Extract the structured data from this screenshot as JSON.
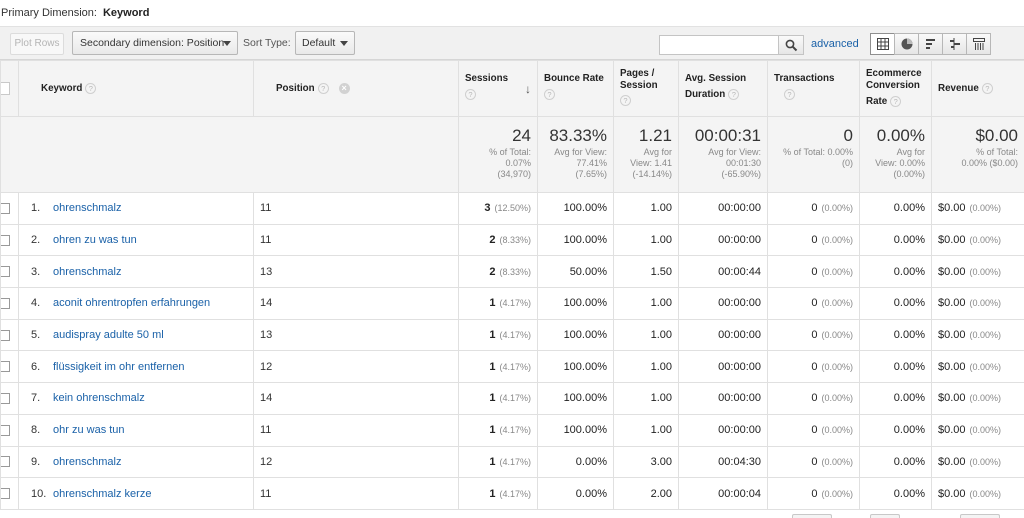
{
  "primary_dimension": {
    "label": "Primary Dimension:",
    "value": "Keyword"
  },
  "toolbar": {
    "plot_rows": "Plot Rows",
    "secondary_dimension": "Secondary dimension: Position",
    "sort_type_label": "Sort Type:",
    "sort_type_value": "Default",
    "search_value": "",
    "advanced": "advanced",
    "view_icons": [
      "table-view-icon",
      "pie-view-icon",
      "performance-view-icon",
      "comparison-view-icon",
      "pivot-view-icon"
    ]
  },
  "columns": {
    "keyword": "Keyword",
    "position": "Position",
    "sessions": "Sessions",
    "bounce_rate": "Bounce Rate",
    "pages_l1": "Pages /",
    "pages_l2": "Session",
    "avg_l1": "Avg. Session",
    "avg_l2": "Duration",
    "transactions": "Transactions",
    "ecom_l1": "Ecommerce",
    "ecom_l2": "Conversion",
    "ecom_l3": "Rate",
    "revenue": "Revenue"
  },
  "totals": {
    "sessions": {
      "big": "24",
      "l1": "% of Total:",
      "l2": "0.07%",
      "l3": "(34,970)"
    },
    "bounce": {
      "big": "83.33%",
      "l1": "Avg for View:",
      "l2": "77.41%",
      "l3": "(7.65%)"
    },
    "pages": {
      "big": "1.21",
      "l1": "Avg for",
      "l2": "View: 1.41",
      "l3": "(-14.14%)"
    },
    "duration": {
      "big": "00:00:31",
      "l1": "Avg for View:",
      "l2": "00:01:30",
      "l3": "(-65.90%)"
    },
    "transactions": {
      "big": "0",
      "l1": "% of Total: 0.00%",
      "l2": "(0)"
    },
    "ecom": {
      "big": "0.00%",
      "l1": "Avg for",
      "l2": "View: 0.00%",
      "l3": "(0.00%)"
    },
    "revenue": {
      "big": "$0.00",
      "l1": "% of Total:",
      "l2": "0.00% ($0.00)"
    }
  },
  "rows": [
    {
      "n": "1.",
      "keyword": "ohrenschmalz",
      "position": "11",
      "sessions": "3",
      "sessions_pct": "(12.50%)",
      "bounce": "100.00%",
      "pages": "1.00",
      "duration": "00:00:00",
      "transactions": "0",
      "transactions_pct": "(0.00%)",
      "ecom": "0.00%",
      "revenue": "$0.00",
      "revenue_pct": "(0.00%)"
    },
    {
      "n": "2.",
      "keyword": "ohren zu was tun",
      "position": "11",
      "sessions": "2",
      "sessions_pct": "(8.33%)",
      "bounce": "100.00%",
      "pages": "1.00",
      "duration": "00:00:00",
      "transactions": "0",
      "transactions_pct": "(0.00%)",
      "ecom": "0.00%",
      "revenue": "$0.00",
      "revenue_pct": "(0.00%)"
    },
    {
      "n": "3.",
      "keyword": "ohrenschmalz",
      "position": "13",
      "sessions": "2",
      "sessions_pct": "(8.33%)",
      "bounce": "50.00%",
      "pages": "1.50",
      "duration": "00:00:44",
      "transactions": "0",
      "transactions_pct": "(0.00%)",
      "ecom": "0.00%",
      "revenue": "$0.00",
      "revenue_pct": "(0.00%)"
    },
    {
      "n": "4.",
      "keyword": "aconit ohrentropfen erfahrungen",
      "position": "14",
      "sessions": "1",
      "sessions_pct": "(4.17%)",
      "bounce": "100.00%",
      "pages": "1.00",
      "duration": "00:00:00",
      "transactions": "0",
      "transactions_pct": "(0.00%)",
      "ecom": "0.00%",
      "revenue": "$0.00",
      "revenue_pct": "(0.00%)"
    },
    {
      "n": "5.",
      "keyword": "audispray adulte 50 ml",
      "position": "13",
      "sessions": "1",
      "sessions_pct": "(4.17%)",
      "bounce": "100.00%",
      "pages": "1.00",
      "duration": "00:00:00",
      "transactions": "0",
      "transactions_pct": "(0.00%)",
      "ecom": "0.00%",
      "revenue": "$0.00",
      "revenue_pct": "(0.00%)"
    },
    {
      "n": "6.",
      "keyword": "flüssigkeit im ohr entfernen",
      "position": "12",
      "sessions": "1",
      "sessions_pct": "(4.17%)",
      "bounce": "100.00%",
      "pages": "1.00",
      "duration": "00:00:00",
      "transactions": "0",
      "transactions_pct": "(0.00%)",
      "ecom": "0.00%",
      "revenue": "$0.00",
      "revenue_pct": "(0.00%)"
    },
    {
      "n": "7.",
      "keyword": "kein ohrenschmalz",
      "position": "14",
      "sessions": "1",
      "sessions_pct": "(4.17%)",
      "bounce": "100.00%",
      "pages": "1.00",
      "duration": "00:00:00",
      "transactions": "0",
      "transactions_pct": "(0.00%)",
      "ecom": "0.00%",
      "revenue": "$0.00",
      "revenue_pct": "(0.00%)"
    },
    {
      "n": "8.",
      "keyword": "ohr zu was tun",
      "position": "11",
      "sessions": "1",
      "sessions_pct": "(4.17%)",
      "bounce": "100.00%",
      "pages": "1.00",
      "duration": "00:00:00",
      "transactions": "0",
      "transactions_pct": "(0.00%)",
      "ecom": "0.00%",
      "revenue": "$0.00",
      "revenue_pct": "(0.00%)"
    },
    {
      "n": "9.",
      "keyword": "ohrenschmalz",
      "position": "12",
      "sessions": "1",
      "sessions_pct": "(4.17%)",
      "bounce": "0.00%",
      "pages": "3.00",
      "duration": "00:04:30",
      "transactions": "0",
      "transactions_pct": "(0.00%)",
      "ecom": "0.00%",
      "revenue": "$0.00",
      "revenue_pct": "(0.00%)"
    },
    {
      "n": "10.",
      "keyword": "ohrenschmalz kerze",
      "position": "11",
      "sessions": "1",
      "sessions_pct": "(4.17%)",
      "bounce": "0.00%",
      "pages": "2.00",
      "duration": "00:00:04",
      "transactions": "0",
      "transactions_pct": "(0.00%)",
      "ecom": "0.00%",
      "revenue": "$0.00",
      "revenue_pct": "(0.00%)"
    }
  ],
  "colors": {
    "link": "#1a61a8",
    "header_bg": "#f4f4f4",
    "border": "#e0e0e0"
  }
}
